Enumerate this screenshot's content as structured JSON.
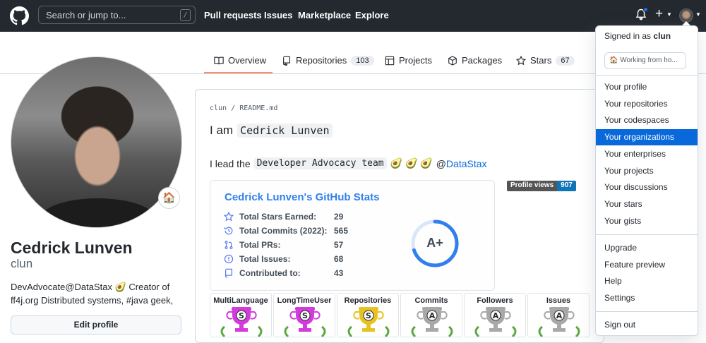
{
  "header": {
    "search_placeholder": "Search or jump to...",
    "search_shortcut": "/",
    "nav": [
      "Pull requests",
      "Issues",
      "Marketplace",
      "Explore"
    ],
    "plus_label": "+"
  },
  "tabs": [
    {
      "label": "Overview",
      "count": null,
      "active": true
    },
    {
      "label": "Repositories",
      "count": "103"
    },
    {
      "label": "Projects",
      "count": null
    },
    {
      "label": "Packages",
      "count": null
    },
    {
      "label": "Stars",
      "count": "67"
    }
  ],
  "profile": {
    "status_emoji": "🏠",
    "name": "Cedrick Lunven",
    "login": "clun",
    "bio": "DevAdvocate@DataStax 🥑 Creator of ff4j.org Distributed systems, #java geek,",
    "edit_label": "Edit profile"
  },
  "readme": {
    "path_user": "clun",
    "path_sep": "/",
    "path_file": "README.md",
    "heading_prefix": "I am",
    "heading_code": "Cedrick Lunven",
    "line_prefix": "I lead the",
    "line_code": "Developer Advocacy team",
    "line_emoji": "🥑 🥑 🥑",
    "line_at": "@",
    "line_link": "DataStax",
    "views_label": "Profile views",
    "views_count": "907"
  },
  "stats": {
    "title": "Cedrick Lunven's GitHub Stats",
    "rows": [
      {
        "icon": "star-icon",
        "label": "Total Stars Earned:",
        "value": "29"
      },
      {
        "icon": "history-icon",
        "label": "Total Commits (2022):",
        "value": "565"
      },
      {
        "icon": "pull-request-icon",
        "label": "Total PRs:",
        "value": "57"
      },
      {
        "icon": "issue-icon",
        "label": "Total Issues:",
        "value": "68"
      },
      {
        "icon": "repo-icon",
        "label": "Contributed to:",
        "value": "43"
      }
    ],
    "grade": "A+",
    "grade_progress": 0.7
  },
  "trophies": [
    {
      "title": "MultiLanguage",
      "rank": "S",
      "color": "#d33bdc"
    },
    {
      "title": "LongTimeUser",
      "rank": "S",
      "color": "#d33bdc"
    },
    {
      "title": "Repositories",
      "rank": "S",
      "color": "#e8c220"
    },
    {
      "title": "Commits",
      "rank": "A",
      "color": "#a8a8a8"
    },
    {
      "title": "Followers",
      "rank": "A",
      "color": "#a8a8a8"
    },
    {
      "title": "Issues",
      "rank": "A",
      "color": "#a8a8a8"
    }
  ],
  "dropdown": {
    "signed_prefix": "Signed in as",
    "signed_user": "clun",
    "status": "🏠 Working from ho...",
    "group1": [
      "Your profile",
      "Your repositories",
      "Your codespaces",
      "Your organizations",
      "Your enterprises",
      "Your projects",
      "Your discussions",
      "Your stars",
      "Your gists"
    ],
    "active": "Your organizations",
    "group2": [
      "Upgrade",
      "Feature preview",
      "Help",
      "Settings"
    ],
    "signout": "Sign out"
  },
  "colors": {
    "header_bg": "#24292f",
    "accent": "#0969da",
    "tab_underline": "#fd8c73",
    "stats_title": "#2f80ed"
  }
}
